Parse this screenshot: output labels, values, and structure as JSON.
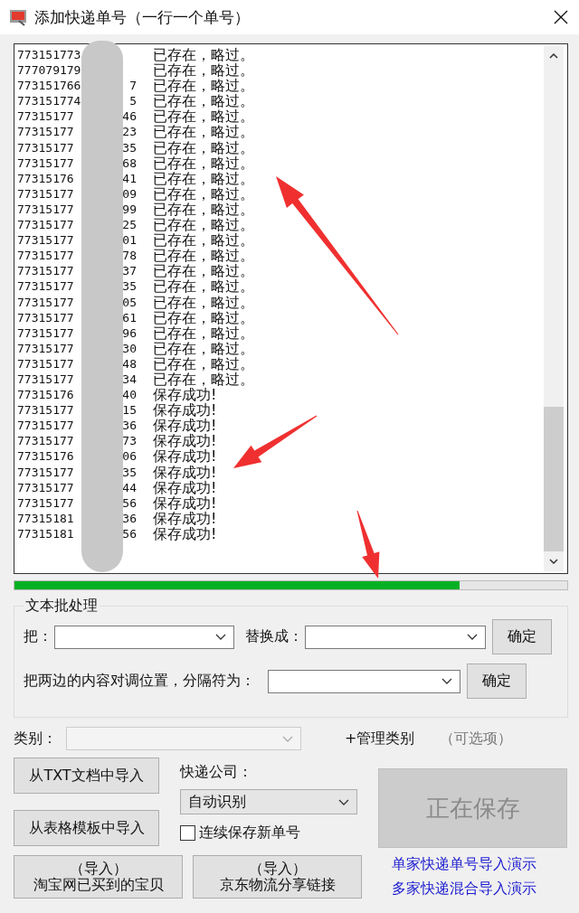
{
  "window": {
    "title": "添加快递单号（一行一个单号）"
  },
  "log": {
    "lines": [
      {
        "number_start": "773151773",
        "status": "已存在，略过。"
      },
      {
        "number_start": "777079179",
        "status": "已存在，略过。"
      },
      {
        "number_start": "773151766",
        "number_end": "7",
        "status": "已存在，略过。"
      },
      {
        "number_start": "773151774",
        "number_end": "5",
        "status": "已存在，略过。"
      },
      {
        "number_start": "77315177",
        "number_end": "46",
        "status": "已存在，略过。"
      },
      {
        "number_start": "77315177",
        "number_end": "23",
        "status": "已存在，略过。"
      },
      {
        "number_start": "77315177",
        "number_end": "35",
        "status": "已存在，略过。"
      },
      {
        "number_start": "77315177",
        "number_end": "68",
        "status": "已存在，略过。"
      },
      {
        "number_start": "77315176",
        "number_end": "41",
        "status": "已存在，略过。"
      },
      {
        "number_start": "77315177",
        "number_end": "09",
        "status": "已存在，略过。"
      },
      {
        "number_start": "77315177",
        "number_end": "99",
        "status": "已存在，略过。"
      },
      {
        "number_start": "77315177",
        "number_end": "25",
        "status": "已存在，略过。"
      },
      {
        "number_start": "77315177",
        "number_end": "01",
        "status": "已存在，略过。"
      },
      {
        "number_start": "77315177",
        "number_end": "78",
        "status": "已存在，略过。"
      },
      {
        "number_start": "77315177",
        "number_end": "37",
        "status": "已存在，略过。"
      },
      {
        "number_start": "77315177",
        "number_end": "35",
        "status": "已存在，略过。"
      },
      {
        "number_start": "77315177",
        "number_end": "05",
        "status": "已存在，略过。"
      },
      {
        "number_start": "77315177",
        "number_end": "61",
        "status": "已存在，略过。"
      },
      {
        "number_start": "77315177",
        "number_end": "96",
        "status": "已存在，略过。"
      },
      {
        "number_start": "77315177",
        "number_end": "30",
        "status": "已存在，略过。"
      },
      {
        "number_start": "77315177",
        "number_end": "48",
        "status": "已存在，略过。"
      },
      {
        "number_start": "77315177",
        "number_end": "34",
        "status": "已存在，略过。"
      },
      {
        "number_start": "77315176",
        "number_end": "40",
        "status": "保存成功!"
      },
      {
        "number_start": "77315177",
        "number_end": "15",
        "status": "保存成功!"
      },
      {
        "number_start": "77315177",
        "number_end": "36",
        "status": "保存成功!"
      },
      {
        "number_start": "77315177",
        "number_end": "73",
        "status": "保存成功!"
      },
      {
        "number_start": "77315176",
        "number_end": "06",
        "status": "保存成功!"
      },
      {
        "number_start": "77315177",
        "number_end": "35",
        "status": "保存成功!"
      },
      {
        "number_start": "77315177",
        "number_end": "44",
        "status": "保存成功!"
      },
      {
        "number_start": "77315177",
        "number_end": "56",
        "status": "保存成功!"
      },
      {
        "number_start": "77315181",
        "number_end": "36",
        "status": "保存成功!"
      },
      {
        "number_start": "77315181",
        "number_end": "56",
        "status": "保存成功!"
      }
    ]
  },
  "progress": {
    "level": 0.806
  },
  "batch": {
    "title": "文本批处理",
    "replace_label": "把：",
    "with_label": "替换成：",
    "confirm": "确定",
    "swap_label": "把两边的内容对调位置，分隔符为：",
    "swap_confirm": "确定"
  },
  "category": {
    "label": "类别：",
    "disabled": true,
    "manage": "+管理类别",
    "hint": "（可选项）"
  },
  "import_buttons": [
    "从TXT文档中导入",
    "从表格模板中导入"
  ],
  "courier": {
    "label": "快递公司：",
    "value": "自动识别"
  },
  "continuous_save": {
    "label": "连续保存新单号",
    "checked": false
  },
  "save_button": {
    "label": "正在保存",
    "disabled": true
  },
  "bottom_buttons": [
    {
      "line1": "（导入）",
      "line2": "淘宝网已买到的宝贝"
    },
    {
      "line1": "（导入）",
      "line2": "京东物流分享链接"
    }
  ],
  "links": [
    "单家快递单号导入演示",
    "多家快递混合导入演示"
  ]
}
